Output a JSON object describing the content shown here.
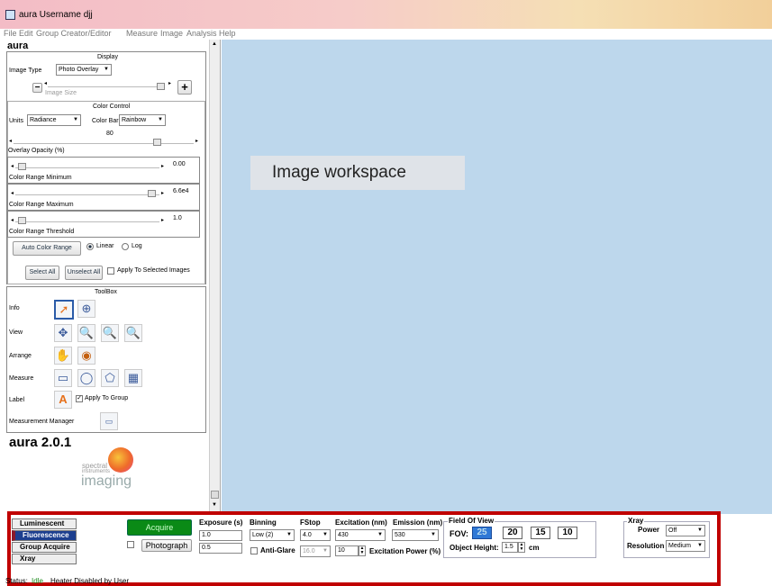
{
  "window": {
    "title": "aura  Username djj"
  },
  "menu": [
    "File",
    "Edit",
    "Group Creator/Editor",
    "Measure",
    "Image",
    "Analysis",
    "Help"
  ],
  "left": {
    "heading": "aura",
    "display_title": "Display",
    "image_type_label": "Image Type",
    "image_type_value": "Photo Overlay",
    "image_size_label": "Image Size",
    "color_control_title": "Color Control",
    "units_label": "Units",
    "units_value": "Radiance",
    "color_bar_label": "Color Bar",
    "color_bar_value": "Rainbow",
    "opacity_value": "80",
    "opacity_level": 0.8,
    "opacity_label": "Overlay Opacity (%)",
    "cr_min_value": "0.00",
    "cr_min_label": "Color Range Minimum",
    "cr_max_value": "6.6e4",
    "cr_max_label": "Color Range Maximum",
    "cr_thr_value": "1.0",
    "cr_thr_label": "Color Range Threshold",
    "auto_color_range": "Auto Color Range",
    "linear": "Linear",
    "log": "Log",
    "select_all": "Select All",
    "unselect_all": "Unselect All",
    "apply_selected": "Apply To Selected Images",
    "toolbox_title": "ToolBox",
    "info": "Info",
    "view": "View",
    "arrange": "Arrange",
    "measure": "Measure",
    "label": "Label",
    "apply_group": "Apply To Group",
    "measurement_manager": "Measurement Manager",
    "version": "aura 2.0.1",
    "logo_text1": "spectral",
    "logo_text2": "instruments",
    "logo_text3": "imaging"
  },
  "workspace": {
    "label": "Image workspace"
  },
  "bottom": {
    "nav": [
      "Luminescent",
      "Fluorescence",
      "Group Acquire",
      "Xray"
    ],
    "acquire": "Acquire",
    "photograph": "Photograph",
    "exposure_label": "Exposure (s)",
    "exposure1": "1.0",
    "exposure2": "0.5",
    "binning_label": "Binning",
    "binning_value": "Low    (2)",
    "antiglare": "Anti-Glare",
    "fstop_label": "FStop",
    "fstop_value": "4.0",
    "fstop2": "16.0",
    "excitation_label": "Excitation (nm)",
    "excitation_value": "430",
    "excitation_power_value": "10",
    "excitation_power_label": "Excitation Power (%)",
    "emission_label": "Emission (nm)",
    "emission_value": "530",
    "fov_title": "Field Of View",
    "fov_label": "FOV:",
    "fov_values": [
      "25",
      "20",
      "15",
      "10"
    ],
    "object_height_label": "Object Height:",
    "object_height_value": "1.5",
    "object_height_unit": "cm",
    "xray_title": "Xray",
    "power_label": "Power",
    "power_value": "Off",
    "resolution_label": "Resolution",
    "resolution_value": "Medium",
    "status_label": "Status:",
    "status_value": "Idle",
    "heater": "Heater Disabled by User"
  },
  "colors": {
    "acquire": "#0a8a16",
    "status_idle": "#1a8a1a",
    "selected_nav": "#1d3f8f",
    "fov_selected": "#2f78d6"
  }
}
